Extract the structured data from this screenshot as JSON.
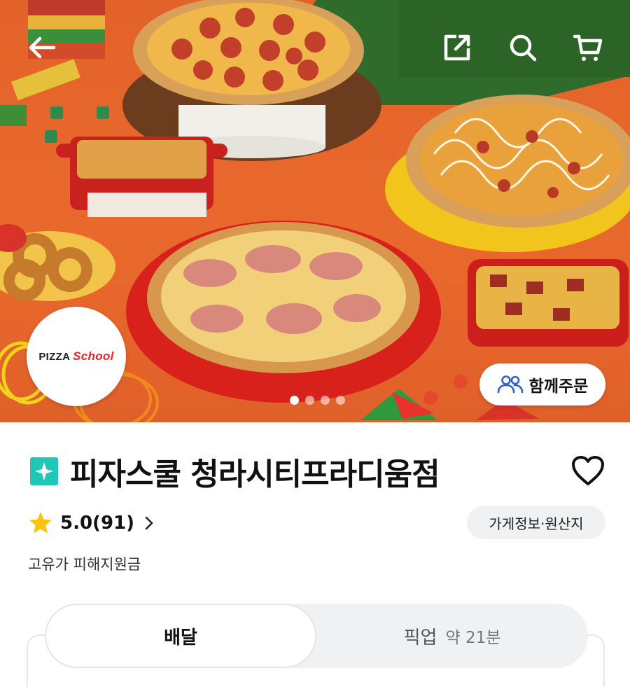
{
  "hero": {
    "logo": {
      "word1": "PIZZA",
      "word2": "School"
    },
    "together_order_label": "함께주문",
    "carousel": {
      "total": 4,
      "active_index": 0
    }
  },
  "topbar": {
    "icons": [
      "back-arrow-icon",
      "share-icon",
      "search-icon",
      "cart-icon"
    ]
  },
  "store": {
    "name": "피자스쿨 청라시티프라디움점",
    "rating": "5.0(91)",
    "info_chip": "가게정보·원산지",
    "subsidy_note": "고유가 피해지원금"
  },
  "order_tabs": {
    "delivery_label": "배달",
    "pickup_label": "픽업",
    "pickup_time": "약 21분",
    "active": "delivery"
  },
  "colors": {
    "accent_teal": "#1fc7b6",
    "star": "#ffc20e",
    "hero_orange": "#e9692c",
    "hero_green": "#2f6b2a"
  }
}
